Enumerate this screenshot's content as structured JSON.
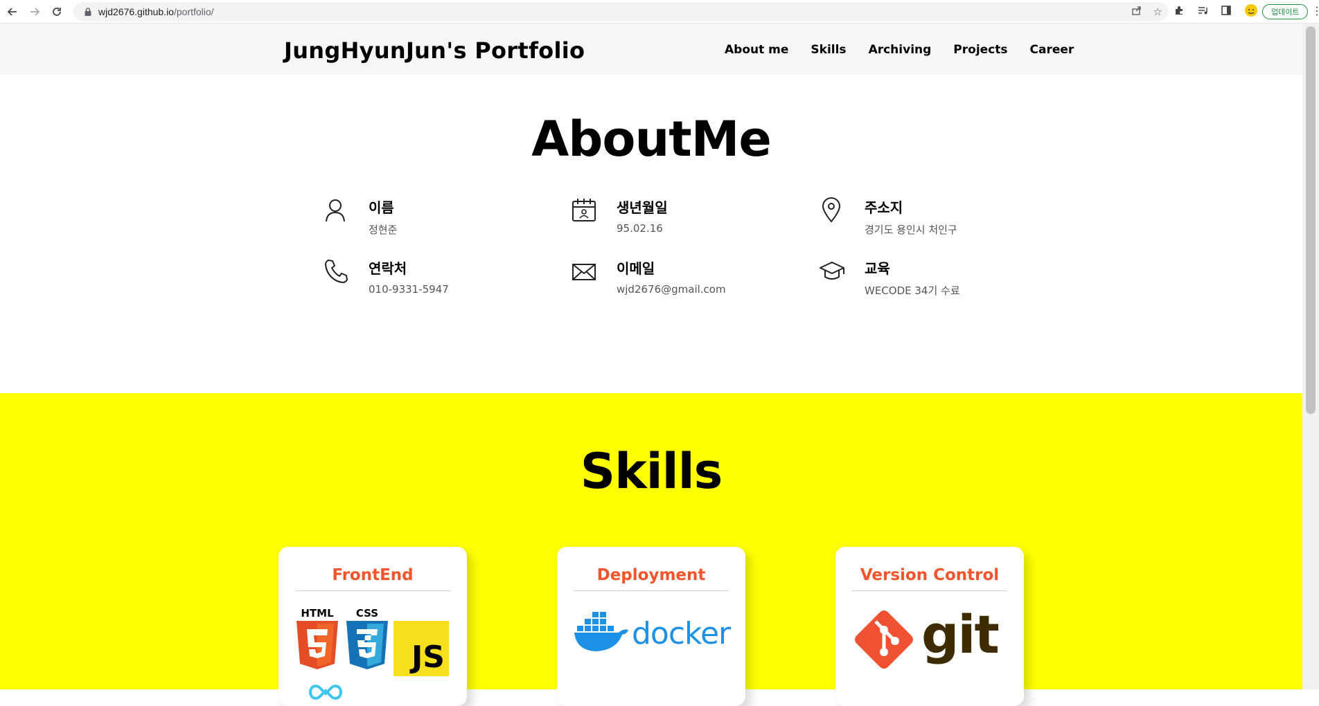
{
  "browser": {
    "url_host": "wjd2676.github.io",
    "url_path": "/portfolio/",
    "update_label": "업데이트"
  },
  "header": {
    "title": "JungHyunJun's Portfolio",
    "nav": [
      "About me",
      "Skills",
      "Archiving",
      "Projects",
      "Career"
    ]
  },
  "about": {
    "title": "AboutMe",
    "items": [
      {
        "icon": "person-icon",
        "label": "이름",
        "value": "정현준"
      },
      {
        "icon": "calendar-icon",
        "label": "생년월일",
        "value": "95.02.16"
      },
      {
        "icon": "location-pin-icon",
        "label": "주소지",
        "value": "경기도 용인시 처인구"
      },
      {
        "icon": "phone-icon",
        "label": "연락처",
        "value": "010-9331-5947"
      },
      {
        "icon": "mail-icon",
        "label": "이메일",
        "value": "wjd2676@gmail.com"
      },
      {
        "icon": "graduation-cap-icon",
        "label": "교육",
        "value": "WECODE 34기 수료"
      }
    ]
  },
  "skills": {
    "title": "Skills",
    "cards": [
      {
        "title": "FrontEnd",
        "logo_text": [
          "HTML",
          "CSS",
          "JS"
        ]
      },
      {
        "title": "Deployment",
        "logo_text": [
          "docker"
        ]
      },
      {
        "title": "Version Control",
        "logo_text": [
          "git"
        ]
      }
    ]
  },
  "colors": {
    "skills_bg": "#ffff00",
    "card_title": "#f2552c",
    "header_bg": "#f6f6f6"
  }
}
